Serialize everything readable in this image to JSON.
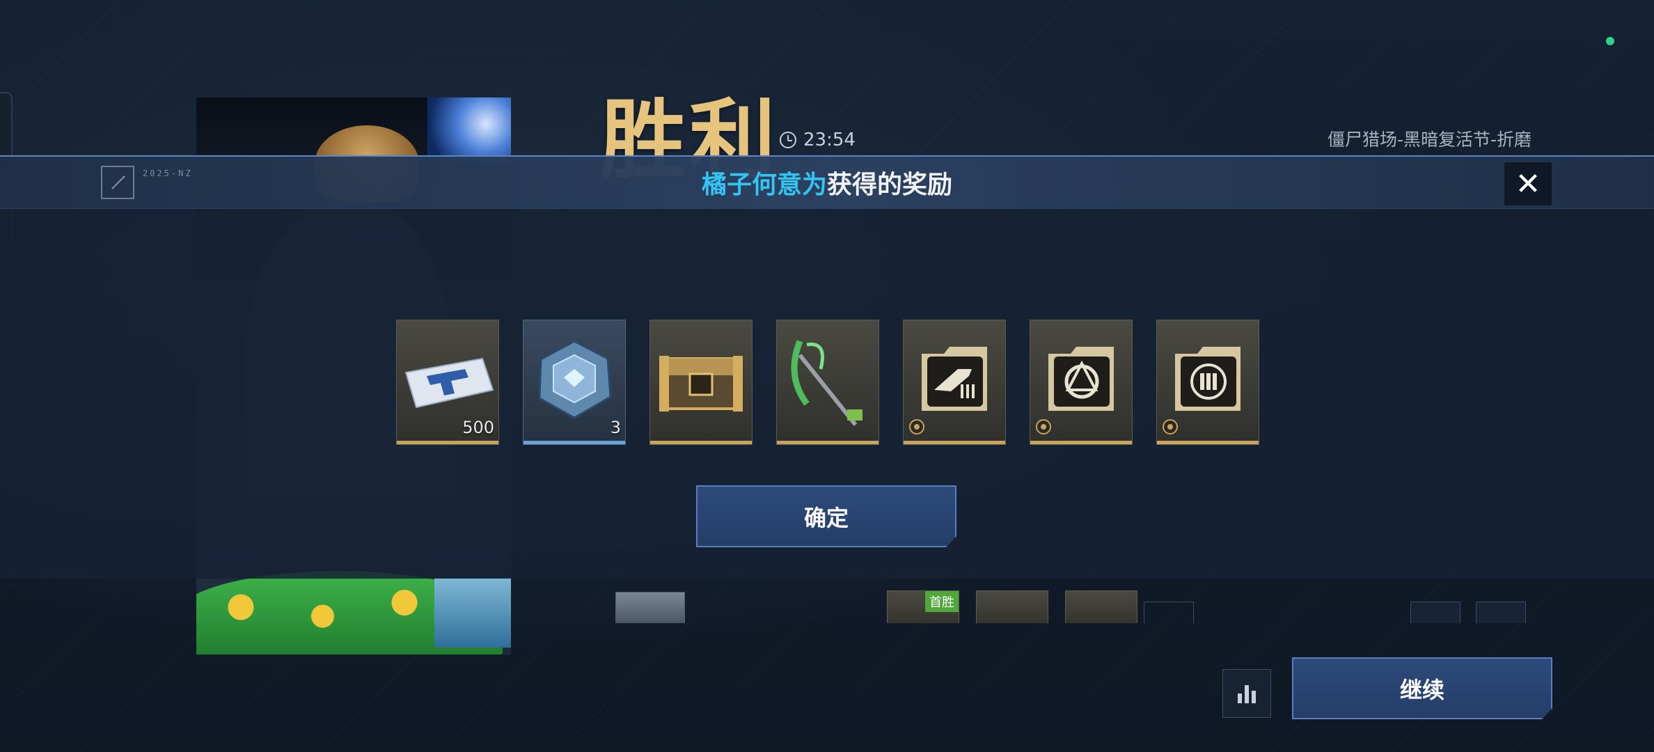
{
  "result": {
    "title": "胜利",
    "time": "23:54",
    "mode": "僵尸猎场-黑暗复活节-折磨"
  },
  "header": {
    "emblem_code": "2025-NZ",
    "player_name": "橘子何意为",
    "suffix": "获得的奖励",
    "close_label": "✕"
  },
  "rewards": [
    {
      "name": "ticket",
      "quantity": "500",
      "rarity": "gold"
    },
    {
      "name": "crystal",
      "quantity": "3",
      "rarity": "blue"
    },
    {
      "name": "chest",
      "quantity": "",
      "rarity": "gold"
    },
    {
      "name": "scythe",
      "quantity": "",
      "rarity": "gold"
    },
    {
      "name": "weapon-blueprint",
      "quantity": "",
      "rarity": "gold"
    },
    {
      "name": "emblem",
      "quantity": "",
      "rarity": "gold"
    },
    {
      "name": "ammo-module",
      "quantity": "",
      "rarity": "gold"
    }
  ],
  "buttons": {
    "confirm": "确定",
    "continue": "继续"
  },
  "lower_row": {
    "first_win_badge": "首胜"
  },
  "colors": {
    "victory_gold": "#e7c47d",
    "player_cyan": "#35c4f2",
    "rarity_gold": "#c9a45a",
    "rarity_blue": "#6aa3d9",
    "button_blue": "#2d4a7a"
  }
}
